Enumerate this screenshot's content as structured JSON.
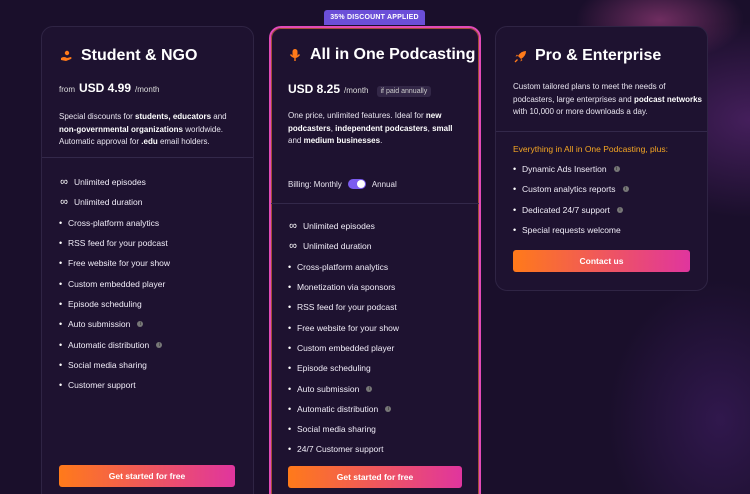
{
  "badge": "35% DISCOUNT APPLIED",
  "student": {
    "title": "Student & NGO",
    "price_from": "from",
    "price": "USD 4.99",
    "period": "/month",
    "desc_html": "Special discounts for <b>students, educators</b> and <b>non-governmental organizations</b> worldwide. Automatic approval for <b>.edu</b> email holders.",
    "features": [
      {
        "icon": "infinity",
        "label": "Unlimited episodes",
        "info": false
      },
      {
        "icon": "infinity",
        "label": "Unlimited duration",
        "info": false
      },
      {
        "icon": "dot",
        "label": "Cross-platform analytics",
        "info": false
      },
      {
        "icon": "dot",
        "label": "RSS feed for your podcast",
        "info": false
      },
      {
        "icon": "dot",
        "label": "Free website for your show",
        "info": false
      },
      {
        "icon": "dot",
        "label": "Custom embedded player",
        "info": false
      },
      {
        "icon": "dot",
        "label": "Episode scheduling",
        "info": false
      },
      {
        "icon": "dot",
        "label": "Auto submission",
        "info": true
      },
      {
        "icon": "dot",
        "label": "Automatic distribution",
        "info": true
      },
      {
        "icon": "dot",
        "label": "Social media sharing",
        "info": false
      },
      {
        "icon": "dot",
        "label": "Customer support",
        "info": false
      }
    ],
    "cta": "Get started for free"
  },
  "podcast": {
    "title": "All in One Podcasting",
    "price": "USD 8.25",
    "period": "/month",
    "paid_tag": "if paid annually",
    "desc_html": "One price, unlimited features. Ideal for <b>new podcasters</b>, <b>independent podcasters</b>, <b>small</b> and <b>medium businesses</b>.",
    "billing_label": "Billing: Monthly",
    "billing_annual": "Annual",
    "features": [
      {
        "icon": "infinity",
        "label": "Unlimited episodes",
        "info": false
      },
      {
        "icon": "infinity",
        "label": "Unlimited duration",
        "info": false
      },
      {
        "icon": "dot",
        "label": "Cross-platform analytics",
        "info": false
      },
      {
        "icon": "dot",
        "label": "Monetization via sponsors",
        "info": false
      },
      {
        "icon": "dot",
        "label": "RSS feed for your podcast",
        "info": false
      },
      {
        "icon": "dot",
        "label": "Free website for your show",
        "info": false
      },
      {
        "icon": "dot",
        "label": "Custom embedded player",
        "info": false
      },
      {
        "icon": "dot",
        "label": "Episode scheduling",
        "info": false
      },
      {
        "icon": "dot",
        "label": "Auto submission",
        "info": true
      },
      {
        "icon": "dot",
        "label": "Automatic distribution",
        "info": true
      },
      {
        "icon": "dot",
        "label": "Social media sharing",
        "info": false
      },
      {
        "icon": "dot",
        "label": "24/7 Customer support",
        "info": false
      }
    ],
    "cta": "Get started for free"
  },
  "pro": {
    "title": "Pro & Enterprise",
    "desc_html": "Custom tailored plans to meet the needs of podcasters, large enterprises and <b>podcast networks</b> with 10,000 or more downloads a day.",
    "plus_heading": "Everything in All in One Podcasting, plus:",
    "features": [
      {
        "icon": "dot",
        "label": "Dynamic Ads Insertion",
        "info": true
      },
      {
        "icon": "dot",
        "label": "Custom analytics reports",
        "info": true
      },
      {
        "icon": "dot",
        "label": "Dedicated 24/7 support",
        "info": true
      },
      {
        "icon": "dot",
        "label": "Special requests welcome",
        "info": false
      }
    ],
    "cta": "Contact us"
  },
  "colors": {
    "accent_orange": "#ff7a1a",
    "accent_pink": "#e0359e",
    "badge_purple": "#6b4fd8",
    "plus_heading": "#f5a623"
  }
}
